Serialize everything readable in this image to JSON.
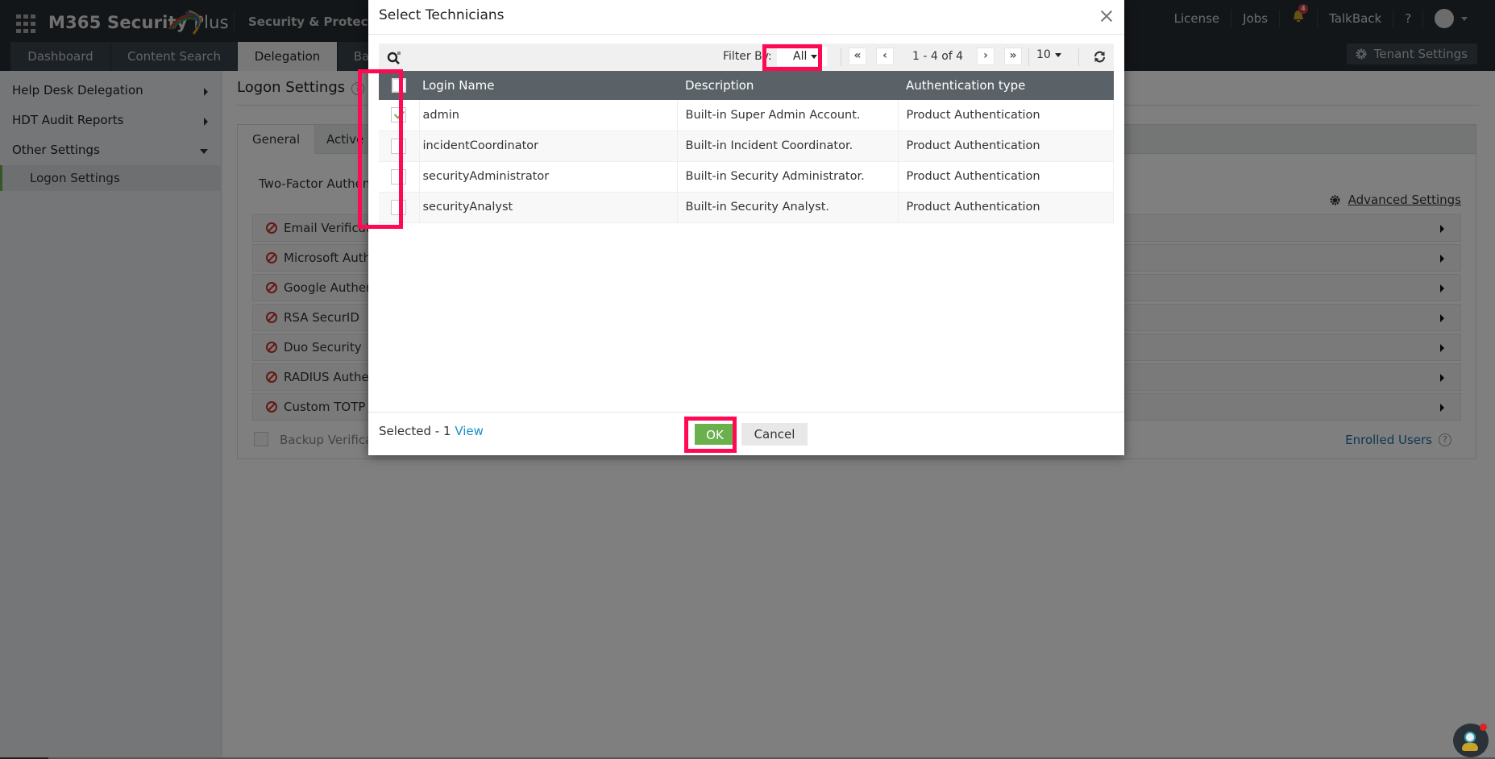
{
  "header": {
    "app_name": "M365 Security",
    "app_name_suffix": "Plus",
    "product_switcher": "Security & Protection",
    "links": [
      "License",
      "Jobs",
      "TalkBack",
      "?"
    ],
    "notification_count": "4"
  },
  "nav": {
    "tabs": [
      "Dashboard",
      "Content Search",
      "Delegation",
      "Ba"
    ],
    "active_tab": "Delegation",
    "tenant_settings": "Tenant Settings"
  },
  "sidebar": {
    "items": [
      {
        "label": "Help Desk Delegation",
        "expanded": false
      },
      {
        "label": "HDT Audit Reports",
        "expanded": false
      },
      {
        "label": "Other Settings",
        "expanded": true
      }
    ],
    "sub_items": [
      {
        "label": "Logon Settings",
        "active": true
      }
    ]
  },
  "main": {
    "title": "Logon Settings",
    "help": "?",
    "tabs": [
      "General",
      "Active D"
    ],
    "two_factor_label": "Two-Factor Authenti",
    "advanced_settings": "Advanced Settings",
    "methods": [
      "Email Verificati",
      "Microsoft Authe",
      "Google Authen",
      "RSA SecurID",
      "Duo Security",
      "RADIUS Authe",
      "Custom TOTP A"
    ],
    "backup_label": "Backup Verificat",
    "enrolled_users": "Enrolled Users"
  },
  "modal": {
    "title": "Select Technicians",
    "filter_label": "Filter By:",
    "filter_value": "All",
    "pagination": {
      "first": "«",
      "prev": "‹",
      "range_text": "1 - 4 of 4",
      "next": "›",
      "last": "»",
      "page_size": "10"
    },
    "columns": [
      "Login Name",
      "Description",
      "Authentication type"
    ],
    "rows": [
      {
        "checked": true,
        "login": "admin",
        "description": "Built-in Super Admin Account.",
        "auth": "Product Authentication"
      },
      {
        "checked": false,
        "login": "incidentCoordinator",
        "description": "Built-in Incident Coordinator.",
        "auth": "Product Authentication"
      },
      {
        "checked": false,
        "login": "securityAdministrator",
        "description": "Built-in Security Administrator.",
        "auth": "Product Authentication"
      },
      {
        "checked": false,
        "login": "securityAnalyst",
        "description": "Built-in Security Analyst.",
        "auth": "Product Authentication"
      }
    ],
    "selected_text": "Selected - 1",
    "view_link": "View",
    "ok_label": "OK",
    "cancel_label": "Cancel"
  },
  "colors": {
    "header_bg": "#272d33",
    "accent_green": "#6ab04c",
    "highlight": "#ff0a52",
    "link_blue": "#1a8fc9",
    "table_header": "#5a6268"
  }
}
